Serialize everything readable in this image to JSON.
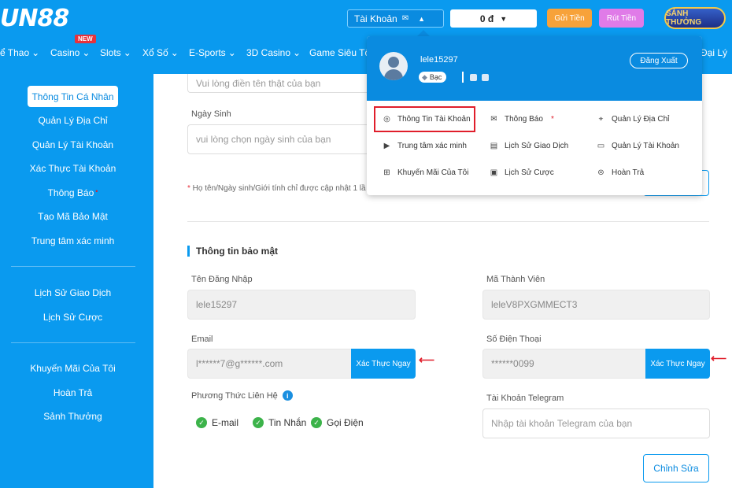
{
  "header": {
    "logo": "UN88",
    "account_label": "Tài Khoản",
    "balance": "0 đ",
    "deposit": "Gửi Tiền",
    "withdraw": "Rút Tiền",
    "hall": "SẢNH THƯỞNG",
    "new_badge": "NEW"
  },
  "nav": {
    "items": [
      "ể Thao",
      "Casino",
      "Slots",
      "Xổ Số",
      "E-Sports",
      "3D Casino",
      "Game Siêu Tố"
    ],
    "right_item": "Đại Lý"
  },
  "sidebar": {
    "active": "Thông Tin Cá Nhân",
    "group1": [
      "Quản Lý Địa Chỉ",
      "Quản Lý Tài Khoản",
      "Xác Thực Tài Khoản",
      "Thông Báo",
      "Tạo Mã Bảo Mật",
      "Trung tâm xác minh"
    ],
    "group2": [
      "Lịch Sử Giao Dịch",
      "Lịch Sử Cược"
    ],
    "group3": [
      "Khuyến Mãi Của Tôi",
      "Hoàn Trả",
      "Sảnh Thưởng"
    ]
  },
  "form": {
    "name_placeholder": "Vui lòng điền tên thật của bạn",
    "birth_label": "Ngày Sinh",
    "birth_placeholder": "vui lòng chọn ngày sinh của bạn",
    "note": "Họ tên/Ngày sinh/Giới tính chỉ được cập nhật 1 lầ",
    "security_title": "Thông tin bảo mật",
    "username_label": "Tên Đăng Nhập",
    "username_value": "lele15297",
    "member_label": "Mã Thành Viên",
    "member_value": "leleV8PXGMMECT3",
    "email_label": "Email",
    "email_value": "l******7@g******.com",
    "email_verify": "Xác Thực Ngay",
    "phone_label": "Số Điện Thoại",
    "phone_value": "******0099",
    "phone_verify": "Xác Thực Ngay",
    "contact_label": "Phương Thức Liên Hệ",
    "contact_options": [
      "E-mail",
      "Tin Nhắn",
      "Gọi Điện"
    ],
    "telegram_label": "Tài Khoản Telegram",
    "telegram_placeholder": "Nhập tài khoản Telegram của bạn",
    "edit": "Chỉnh Sửa"
  },
  "dropdown": {
    "username": "lele15297",
    "rank": "Bạc",
    "logout": "Đăng Xuất",
    "items": [
      {
        "label": "Thông Tin Tài Khoản",
        "icon": "user-circle-icon"
      },
      {
        "label": "Thông Báo",
        "icon": "envelope-icon"
      },
      {
        "label": "Quản Lý Địa Chỉ",
        "icon": "location-pin-icon"
      },
      {
        "label": "Trung tâm xác minh",
        "icon": "play-box-icon"
      },
      {
        "label": "Lịch Sử Giao Dịch",
        "icon": "document-icon"
      },
      {
        "label": "Quản Lý Tài Khoản",
        "icon": "card-icon"
      },
      {
        "label": "Khuyến Mãi Của Tôi",
        "icon": "gift-icon"
      },
      {
        "label": "Lịch Sử Cược",
        "icon": "clipboard-icon"
      },
      {
        "label": "Hoàn Trả",
        "icon": "refund-icon"
      }
    ]
  },
  "colors": {
    "brand": "#0a9aef",
    "highlight": "#e01e2b"
  }
}
